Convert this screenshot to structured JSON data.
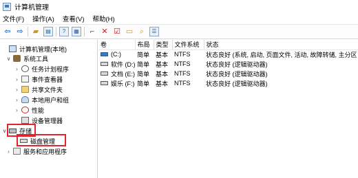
{
  "window": {
    "title": "计算机管理"
  },
  "menu": [
    "文件(F)",
    "操作(A)",
    "查看(V)",
    "帮助(H)"
  ],
  "toolbar": {
    "icons": [
      "back-arrow-icon",
      "forward-arrow-icon",
      "up-folder-icon",
      "show-hide-tree-icon",
      "help-icon",
      "properties-icon",
      "map-drive-icon",
      "delete-icon",
      "check-icon",
      "new-folder-icon",
      "search-icon",
      "list-icon"
    ]
  },
  "tree": [
    {
      "label": "计算机管理(本地)",
      "icon": "computer-icon",
      "level": 0,
      "chevron": ""
    },
    {
      "label": "系统工具",
      "icon": "tools-icon",
      "level": 1,
      "chevron": "∨"
    },
    {
      "label": "任务计划程序",
      "icon": "clock-icon",
      "level": 2,
      "chevron": "›"
    },
    {
      "label": "事件查看器",
      "icon": "event-viewer-icon",
      "level": 2,
      "chevron": "›"
    },
    {
      "label": "共享文件夹",
      "icon": "shared-folder-icon",
      "level": 2,
      "chevron": "›"
    },
    {
      "label": "本地用户和组",
      "icon": "users-icon",
      "level": 2,
      "chevron": "›"
    },
    {
      "label": "性能",
      "icon": "performance-icon",
      "level": 2,
      "chevron": "›"
    },
    {
      "label": "设备管理器",
      "icon": "device-manager-icon",
      "level": 2,
      "chevron": ""
    },
    {
      "label": "存储",
      "icon": "storage-icon",
      "level": 1,
      "chevron": "∨"
    },
    {
      "label": "磁盘管理",
      "icon": "disk-icon",
      "level": 2,
      "chevron": ""
    },
    {
      "label": "服务和应用程序",
      "icon": "services-icon",
      "level": 1,
      "chevron": "›"
    }
  ],
  "table": {
    "columns": [
      "卷",
      "布局",
      "类型",
      "文件系统",
      "状态"
    ],
    "rows": [
      [
        "(C:)",
        "简单",
        "基本",
        "NTFS",
        "状态良好 (系统, 启动, 页面文件, 活动, 故障转储, 主分区"
      ],
      [
        "软件 (D:)",
        "简单",
        "基本",
        "NTFS",
        "状态良好 (逻辑驱动器)"
      ],
      [
        "文档 (E:)",
        "简单",
        "基本",
        "NTFS",
        "状态良好 (逻辑驱动器)"
      ],
      [
        "娱乐 (F:)",
        "简单",
        "基本",
        "NTFS",
        "状态良好 (逻辑驱动器)"
      ]
    ]
  }
}
